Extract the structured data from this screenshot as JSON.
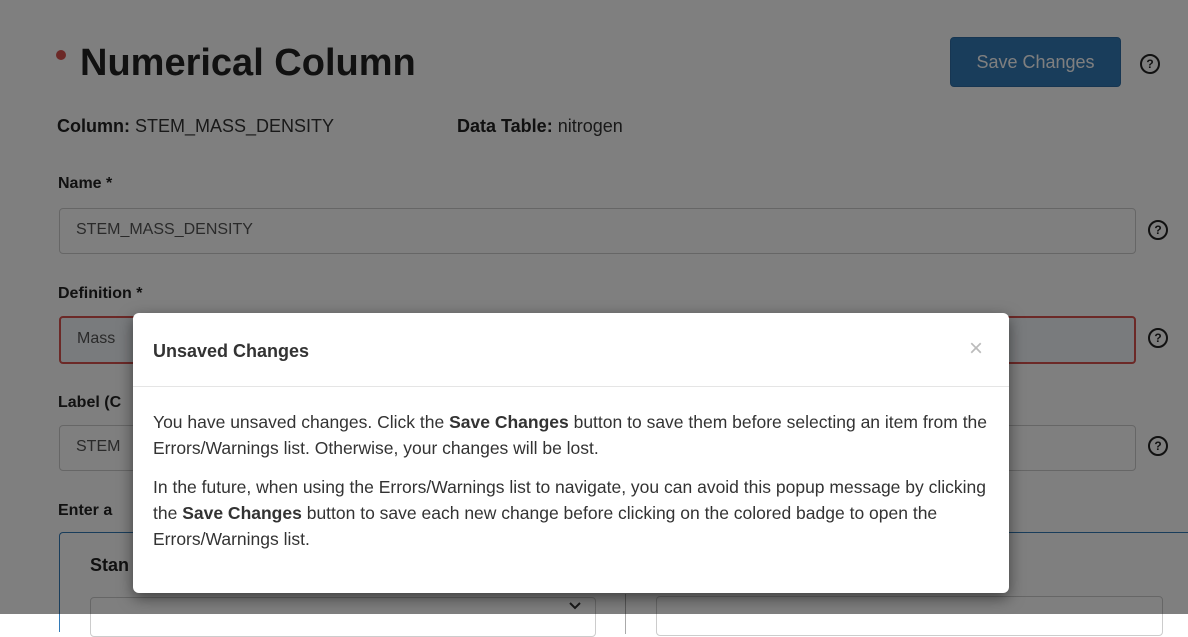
{
  "page": {
    "title": "Numerical Column",
    "save_button": "Save Changes",
    "help_glyph": "?",
    "meta": {
      "column_label": "Column:",
      "column_value": "STEM_MASS_DENSITY",
      "table_label": "Data Table:",
      "table_value": "nitrogen"
    },
    "fields": {
      "name": {
        "label": "Name *",
        "value": "STEM_MASS_DENSITY"
      },
      "definition": {
        "label": "Definition *",
        "value": "Mass"
      },
      "label_field": {
        "label": "Label (C",
        "value": "STEM"
      }
    },
    "enter_section": {
      "label": "Enter a",
      "panel_label": "Stan"
    }
  },
  "modal": {
    "title": "Unsaved Changes",
    "close_glyph": "×",
    "p1_pre": "You have unsaved changes. Click the ",
    "p1_bold": "Save Changes",
    "p1_post": " button to save them before selecting an item from the Errors/Warnings list. Otherwise, your changes will be lost.",
    "p2_pre": "In the future, when using the Errors/Warnings list to navigate, you can avoid this popup message by clicking the ",
    "p2_bold": "Save Changes",
    "p2_post": " button to save each new change before clicking on the colored badge to open the Errors/Warnings list."
  },
  "icons": {
    "chevron": "chevron-down-icon",
    "help": "help-circle-icon",
    "close": "close-icon"
  },
  "colors": {
    "primary": "#337ab7",
    "error": "#d9534f",
    "required_dot": "#d9534f"
  }
}
